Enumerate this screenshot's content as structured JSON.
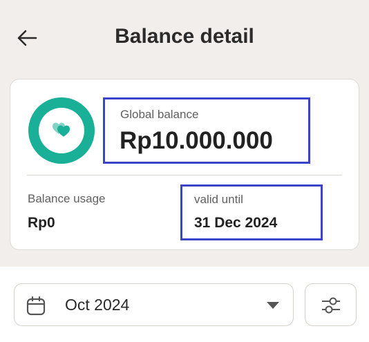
{
  "header": {
    "title": "Balance detail",
    "back_icon": "arrow-left-icon"
  },
  "balance_card": {
    "icon": "heart-icon",
    "global_balance_label": "Global balance",
    "global_balance_value": "Rp10.000.000",
    "balance_usage_label": "Balance usage",
    "balance_usage_value": "Rp0",
    "valid_until_label": "valid until",
    "valid_until_value": "31 Dec 2024"
  },
  "filter": {
    "month_value": "Oct 2024",
    "calendar_icon": "calendar-icon",
    "dropdown_icon": "caret-down-icon",
    "filter_icon": "sliders-icon"
  },
  "colors": {
    "accent": "#1aaf97",
    "highlight_border": "#3a43c9",
    "background": "#f1eeeb"
  }
}
